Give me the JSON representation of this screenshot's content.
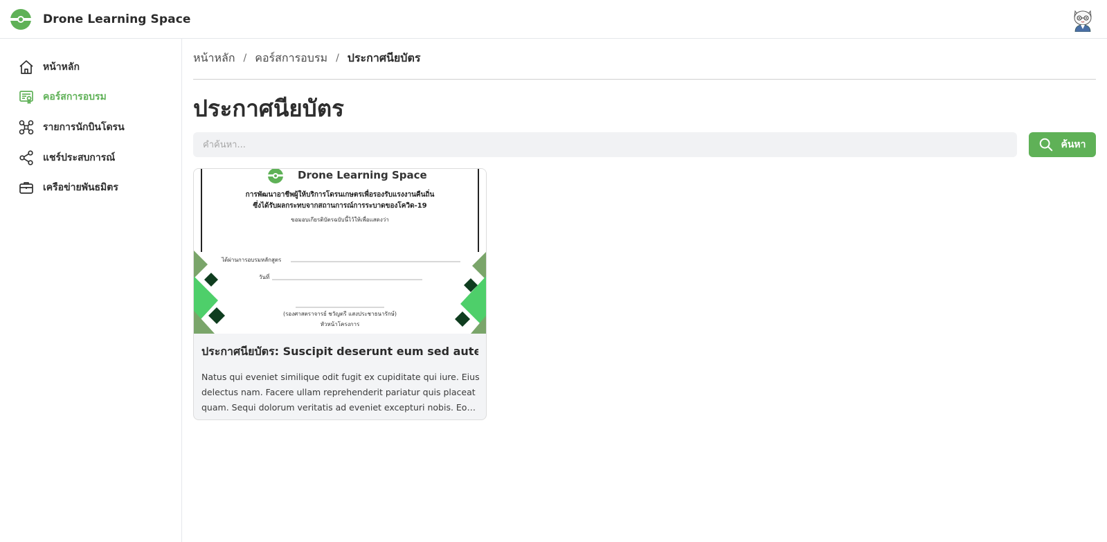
{
  "app": {
    "brand_name": "Drone Learning Space",
    "accent_color": "#5fb157",
    "logo_icon": "drone-logo-icon",
    "avatar_icon": "cat-avatar-icon"
  },
  "sidebar": {
    "items": [
      {
        "label": "หน้าหลัก",
        "icon": "home-icon",
        "active": false
      },
      {
        "label": "คอร์สการอบรม",
        "icon": "certificate-icon",
        "active": true
      },
      {
        "label": "รายการนักบินโดรน",
        "icon": "drone-icon",
        "active": false
      },
      {
        "label": "แชร์ประสบการณ์",
        "icon": "share-icon",
        "active": false
      },
      {
        "label": "เครือข่ายพันธมิตร",
        "icon": "briefcase-icon",
        "active": false
      }
    ]
  },
  "breadcrumb": {
    "items": [
      "หน้าหลัก",
      "คอร์สการอบรม",
      "ประกาศนียบัตร"
    ],
    "separator": "/"
  },
  "page": {
    "title": "ประกาศนียบัตร"
  },
  "search": {
    "placeholder": "คำค้นหา...",
    "value": "",
    "button_label": "ค้นหา",
    "button_icon": "search-icon"
  },
  "cards": [
    {
      "title": "ประกาศนียบัตร: Suscipit deserunt eum sed autem.",
      "description": "Natus qui eveniet similique odit fugit ex cupiditate qui iure. Eius delectus nam. Facere ullam reprehenderit pariatur quis placeat quam. Sequi dolorum veritatis ad eveniet excepturi nobis. Eos eius quia.",
      "image": {
        "brand": "Drone Learning Space",
        "line1": "การพัฒนาอาชีพผู้ให้บริการโดรนเกษตรเพื่อรองรับแรงงานคืนถิ่น",
        "line2": "ซึ่งได้รับผลกระทบจากสถานการณ์การระบาดของโควิด-19",
        "line3": "ขอมอบเกียรติบัตรฉบับนี้ไว้ให้เพื่อแสดงว่า",
        "field1": "ได้ผ่านการอบรมหลักสูตร",
        "field2": "วันที่",
        "signer": "(รองศาสตราจารย์ ชวัญตรี แสงประชาธนารักษ์)",
        "role": "หัวหน้าโครงการ"
      }
    }
  ]
}
